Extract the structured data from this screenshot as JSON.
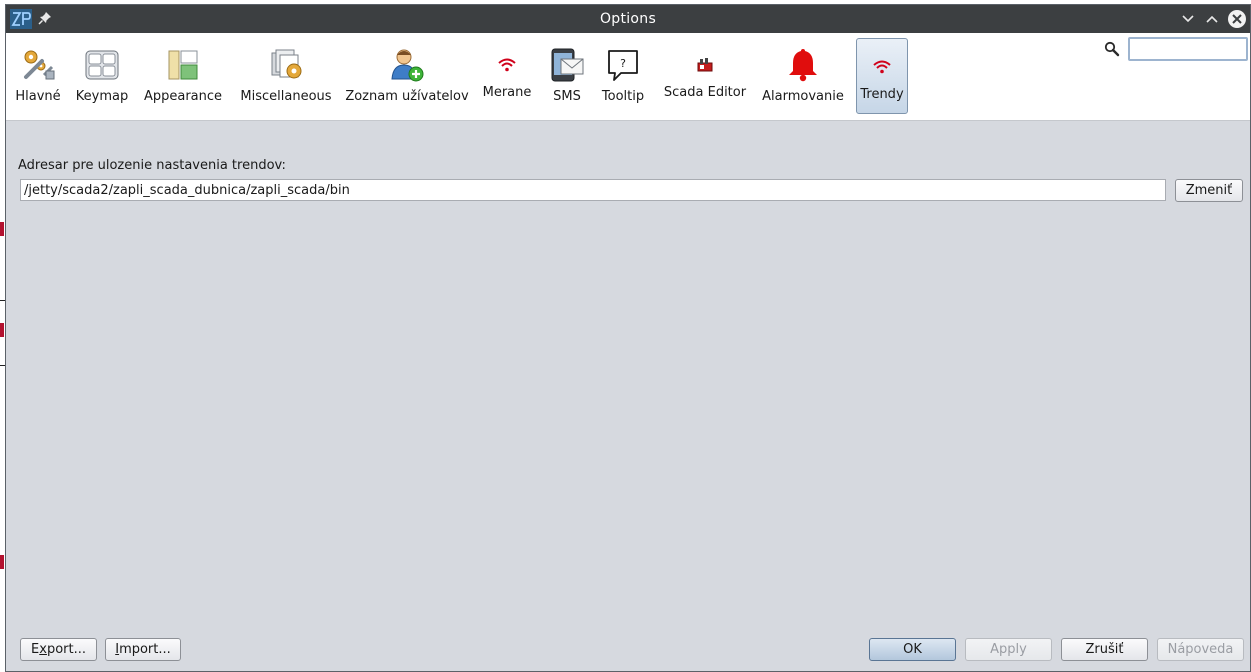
{
  "window": {
    "title": "Options",
    "app_logo_icon": "zp-logo-icon",
    "pin_icon": "pin-icon",
    "controls": [
      "minimize-icon",
      "maximize-icon",
      "close-icon"
    ]
  },
  "categories": [
    {
      "label": "Hlavné",
      "icon": "gears-wrench-icon"
    },
    {
      "label": "Keymap",
      "icon": "keyboard-icon"
    },
    {
      "label": "Appearance",
      "icon": "layout-panels-icon"
    },
    {
      "label": "Miscellaneous",
      "icon": "documents-gear-icon"
    },
    {
      "label": "Zoznam užívatelov",
      "icon": "user-add-icon"
    },
    {
      "label": "Merane",
      "icon": "wifi-signal-icon"
    },
    {
      "label": "SMS",
      "icon": "phone-mail-icon"
    },
    {
      "label": "Tooltip",
      "icon": "speech-bubble-question-icon"
    },
    {
      "label": "Scada Editor",
      "icon": "scada-editor-icon"
    },
    {
      "label": "Alarmovanie",
      "icon": "bell-icon"
    },
    {
      "label": "Trendy",
      "icon": "wifi-signal-icon",
      "selected": true
    }
  ],
  "search": {
    "value": "",
    "icon": "search-icon"
  },
  "panel": {
    "path_label": "Adresar pre ulozenie nastavenia trendov:",
    "path_value": "/jetty/scada2/zapli_scada_dubnica/zapli_scada/bin",
    "change_button": "Zmeniť"
  },
  "footer": {
    "export_prefix": "E",
    "export_mnemonic": "x",
    "export_suffix": "port...",
    "import_mnemonic": "I",
    "import_suffix": "mport...",
    "ok": "OK",
    "apply": "Apply",
    "cancel": "Zrušiť",
    "help": "Nápoveda"
  },
  "colors": {
    "titlebar": "#3c3f41",
    "panel_bg": "#d6d9df",
    "selected_tab": "#c6d6e7",
    "signal_red": "#d0021b",
    "bell_red": "#e00d0d"
  }
}
